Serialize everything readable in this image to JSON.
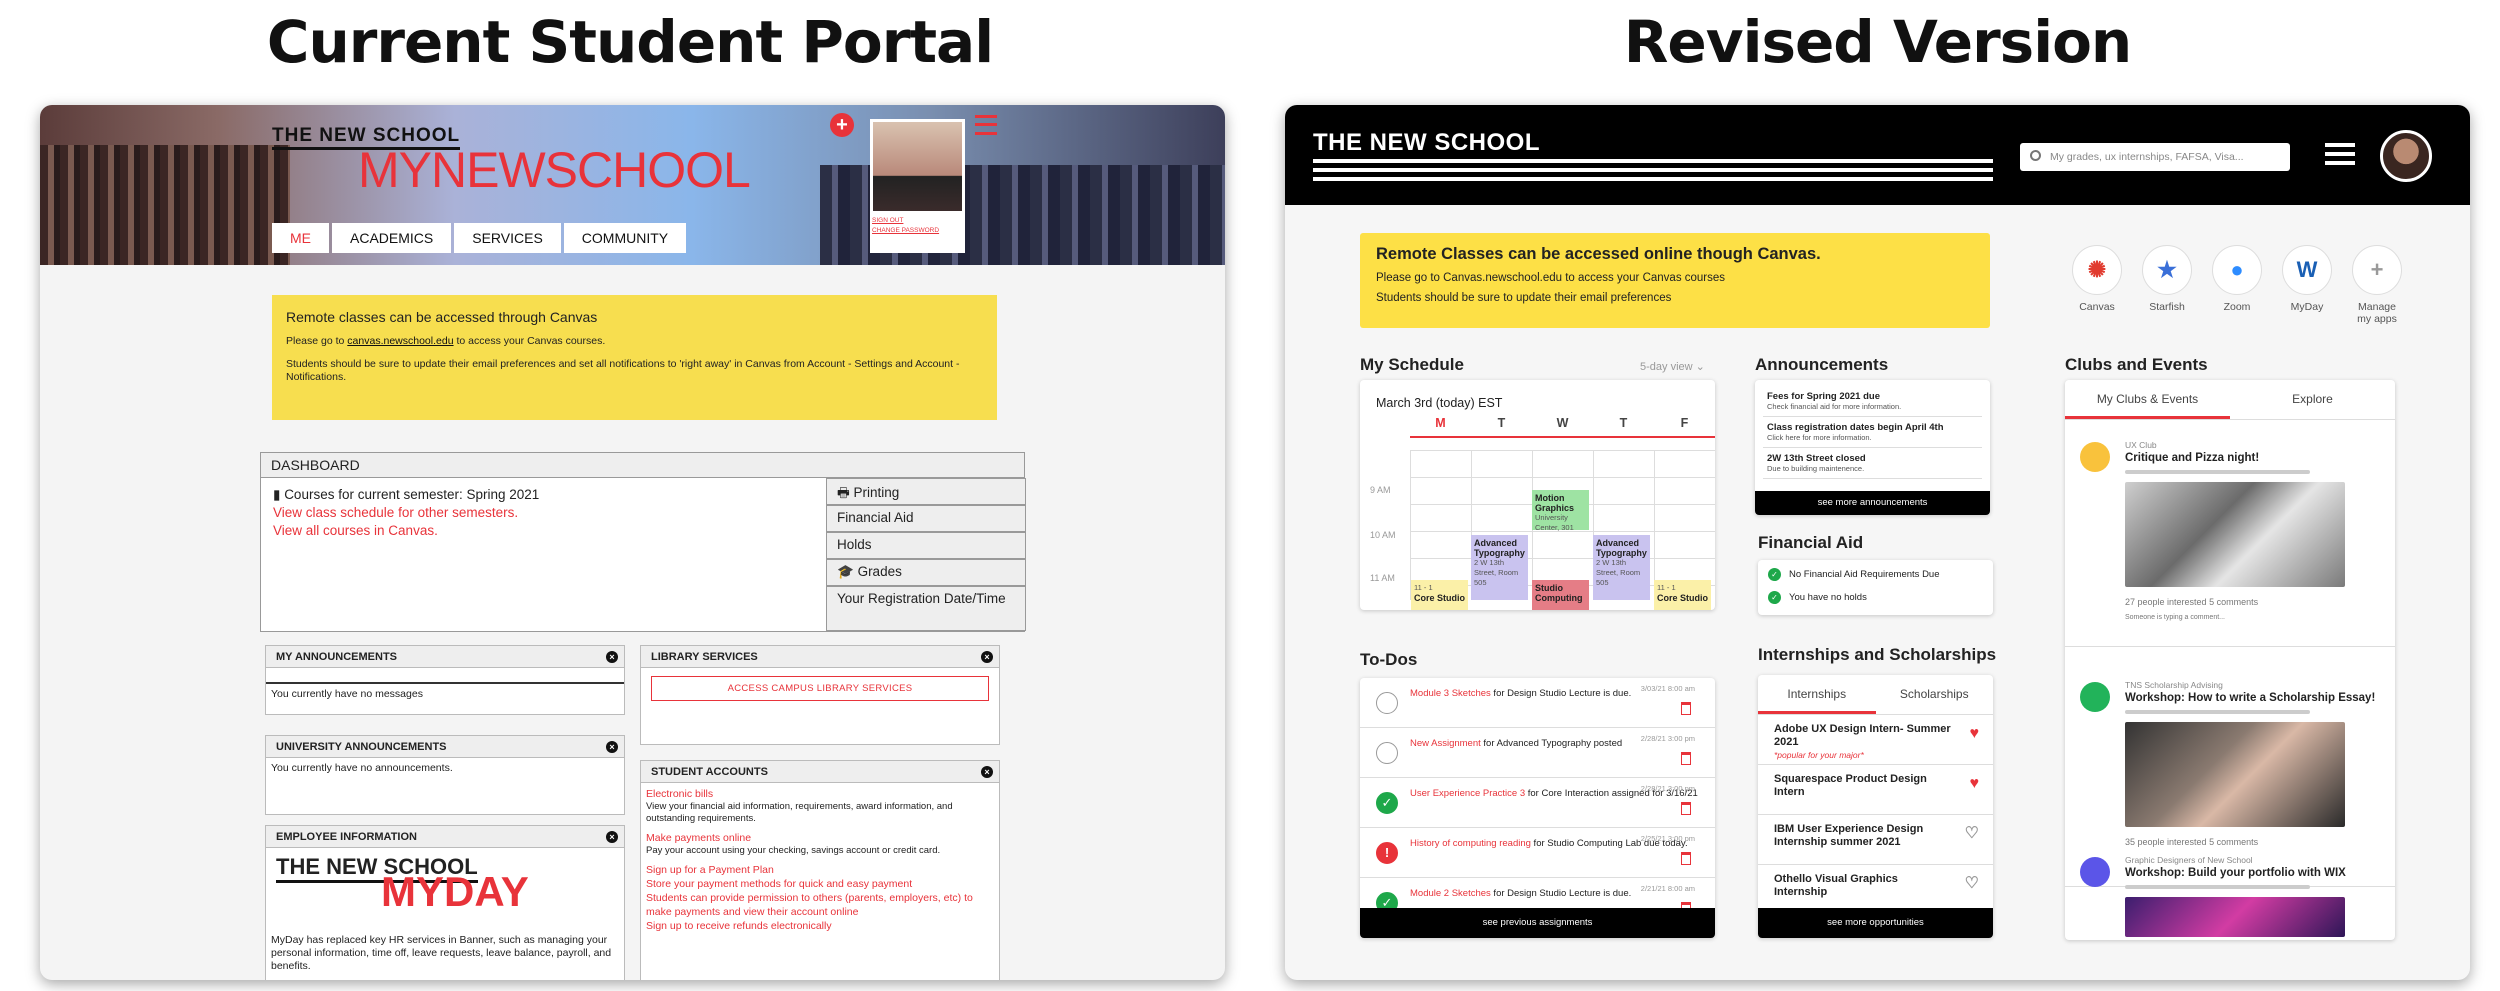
{
  "titles": {
    "left": "Current Student Portal",
    "right": "Revised Version"
  },
  "old": {
    "logo_small": "THE NEW SCHOOL",
    "logo_big": "MYNEWSCHOOL",
    "sign_out": "SIGN OUT",
    "change_password": "CHANGE PASSWORD",
    "nav": [
      "ME",
      "ACADEMICS",
      "SERVICES",
      "COMMUNITY"
    ],
    "notice": {
      "title": "Remote classes can be accessed through Canvas",
      "line1_pre": "Please go to ",
      "line1_link": "canvas.newschool.edu",
      "line1_post": " to access your Canvas courses.",
      "line2": "Students should be sure to update their email preferences and set all notifications to 'right away' in Canvas from Account - Settings and Account - Notifications."
    },
    "dashboard": {
      "title": "DASHBOARD",
      "courses": "Courses for current semester: Spring 2021",
      "link1": "View class schedule for other semesters.",
      "link2": "View all courses in Canvas.",
      "side": [
        "Printing",
        "Financial Aid",
        "Holds",
        "Grades",
        "Your Registration Date/Time"
      ]
    },
    "my_ann": {
      "title": "MY ANNOUNCEMENTS",
      "text": "You currently have no messages"
    },
    "uni_ann": {
      "title": "UNIVERSITY ANNOUNCEMENTS",
      "text": "You currently have no announcements."
    },
    "employee": {
      "title": "EMPLOYEE INFORMATION",
      "logo_a": "THE NEW SCHOOL",
      "logo_b": "MYDAY",
      "text": "MyDay has replaced key HR services in Banner, such as managing your personal information, time off, leave requests, leave balance, payroll, and benefits."
    },
    "library": {
      "title": "LIBRARY SERVICES",
      "button": "ACCESS CAMPUS LIBRARY SERVICES"
    },
    "accounts": {
      "title": "STUDENT ACCOUNTS",
      "items": [
        {
          "link": "Electronic bills",
          "sub": "View your financial aid information, requirements, award information, and outstanding requirements."
        },
        {
          "link": "Make payments online",
          "sub": "Pay your account using your checking, savings account or credit card."
        },
        {
          "link": "Sign up for a Payment Plan",
          "sub": ""
        },
        {
          "link": "Store your payment methods for quick and easy payment",
          "sub": ""
        },
        {
          "link": "Students can provide permission to others (parents, employers, etc) to make payments and view their account online",
          "sub": ""
        },
        {
          "link": "Sign up to receive refunds electronically",
          "sub": ""
        }
      ]
    }
  },
  "new": {
    "logo": "THE NEW SCHOOL",
    "search_placeholder": "My grades, ux internships, FAFSA, Visa...",
    "notice": {
      "title": "Remote Classes can be accessed online though Canvas.",
      "line1": "Please go to Canvas.newschool.edu to access your Canvas courses",
      "line2": "Students should be sure to update their email preferences"
    },
    "apps": [
      {
        "icon": "canvas-icon",
        "glyph": "✺",
        "label": "Canvas",
        "color": "#e13b2f"
      },
      {
        "icon": "starfish-icon",
        "glyph": "★",
        "label": "Starfish",
        "color": "#3a6fd8"
      },
      {
        "icon": "zoom-icon",
        "glyph": "●",
        "label": "Zoom",
        "color": "#2d8cff"
      },
      {
        "icon": "myday-icon",
        "glyph": "W",
        "label": "MyDay",
        "color": "#1a5fb4"
      },
      {
        "icon": "plus-icon",
        "glyph": "+",
        "label": "Manage my apps",
        "color": "#999"
      }
    ],
    "schedule": {
      "title": "My Schedule",
      "view": "5-day view",
      "date": "March 3rd (today) EST",
      "days": [
        "M",
        "T",
        "W",
        "T",
        "F"
      ],
      "times": [
        "9 AM",
        "10 AM",
        "11 AM"
      ],
      "events": [
        {
          "name": "Motion Graphics",
          "loc": "University Center, 301"
        },
        {
          "name": "Advanced Typography",
          "loc": "2 W 13th Street, Room 505"
        },
        {
          "name": "Advanced Typography",
          "loc": "2 W 13th Street, Room 505"
        },
        {
          "name": "Studio Computing",
          "loc": ""
        },
        {
          "name": "Core Studio",
          "loc": "11 - 1"
        },
        {
          "name": "Core Studio",
          "loc": "11 - 1"
        }
      ]
    },
    "announcements": {
      "title": "Announcements",
      "items": [
        {
          "t": "Fees for Spring 2021 due",
          "s": "Check financial aid for more information."
        },
        {
          "t": "Class registration dates begin April 4th",
          "s": "Click here for more information."
        },
        {
          "t": "2W 13th Street closed",
          "s": "Due to building maintenence."
        }
      ],
      "more": "see more announcements"
    },
    "finaid": {
      "title": "Financial Aid",
      "items": [
        "No Financial Aid Requirements Due",
        "You have no holds"
      ]
    },
    "todos": {
      "title": "To-Dos",
      "items": [
        {
          "red": "Module 3 Sketches",
          "rest": " for Design Studio Lecture is due.",
          "date": "3/03/21 8:00 am",
          "state": "open"
        },
        {
          "red": "New Assignment",
          "rest": " for Advanced Typography posted",
          "date": "2/28/21 3:00 pm",
          "state": "open"
        },
        {
          "red": "User Experience Practice 3",
          "rest": " for Core Interaction assigned for 3/16/21",
          "date": "2/28/21 3:00 pm",
          "state": "done"
        },
        {
          "red": "History of computing reading",
          "rest": " for Studio Computing Lab due today.",
          "date": "2/25/21 3:00 pm",
          "state": "alert"
        },
        {
          "red": "Module 2 Sketches",
          "rest": " for Design Studio Lecture is due.",
          "date": "2/21/21 8:00 am",
          "state": "done"
        }
      ],
      "more": "see previous assignments"
    },
    "internships": {
      "title": "Internships and Scholarships",
      "tabs": [
        "Internships",
        "Scholarships"
      ],
      "items": [
        {
          "t": "Adobe UX Design Intern- Summer 2021",
          "note": "*popular for your major*",
          "fav": true
        },
        {
          "t": "Squarespace Product Design Intern",
          "note": "",
          "fav": true
        },
        {
          "t": "IBM User Experience Design Internship summer 2021",
          "note": "",
          "fav": false
        },
        {
          "t": "Othello Visual Graphics Internship",
          "note": "",
          "fav": false
        }
      ],
      "more": "see more opportunities"
    },
    "clubs": {
      "title": "Clubs and Events",
      "tabs": [
        "My Clubs & Events",
        "Explore"
      ],
      "items": [
        {
          "org": "UX Club",
          "title": "Critique and Pizza night!",
          "interested": "27 people interested",
          "comments": "5 comments",
          "typing": "Someone is typing a comment...",
          "color": "#f9c23c"
        },
        {
          "org": "TNS Scholarship Advising",
          "title": "Workshop: How to write a Scholarship Essay!",
          "interested": "35 people interested",
          "comments": "5 comments",
          "typing": "",
          "color": "#22b35a"
        },
        {
          "org": "Graphic Designers of New School",
          "title": "Workshop: Build your portfolio with WIX",
          "interested": "",
          "comments": "",
          "typing": "",
          "color": "#5b55e8"
        }
      ]
    }
  }
}
